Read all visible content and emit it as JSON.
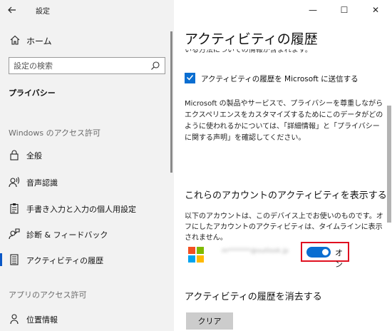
{
  "window": {
    "app_title": "設定",
    "controls": {
      "minimize": "—",
      "maximize": "☐",
      "close": "✕"
    }
  },
  "sidebar": {
    "back_icon": "arrow-left-icon",
    "home_label": "ホーム",
    "search_placeholder": "設定の検索",
    "heading": "プライバシー",
    "section_windows": "Windows のアクセス許可",
    "items": [
      {
        "label": "全般",
        "icon": "lock-icon"
      },
      {
        "label": "音声認識",
        "icon": "speech-icon"
      },
      {
        "label": "手書き入力と入力の個人用設定",
        "icon": "clipboard-pen-icon"
      },
      {
        "label": "診断 & フィードバック",
        "icon": "feedback-icon"
      },
      {
        "label": "アクティビティの履歴",
        "icon": "activity-history-icon",
        "selected": true
      }
    ],
    "section_apps": "アプリのアクセス許可",
    "app_items": [
      {
        "label": "位置情報",
        "icon": "location-icon"
      }
    ]
  },
  "content": {
    "page_title": "アクティビティの履歴",
    "cut_text": "いる方法についての情報が含まれます。",
    "checkbox_label": "アクティビティの履歴を Microsoft に送信する",
    "checkbox_checked": true,
    "paragraph": "Microsoft の製品やサービスで、プライバシーを尊重しながらエクスペリエンスをカスタマイズするためにこのデータがどのように使われるかについては、「詳細情報」と「プライバシーに関する声明」を確認してください。",
    "accounts_heading": "これらのアカウントのアクティビティを表示する",
    "accounts_desc": "以下のアカウントは、このデバイス上でお使いのものです。オフにしたアカウントのアクティビティは、タイムラインに表示されません。",
    "account_email": "m*******@outlook.jp",
    "toggle_state": "オン",
    "toggle_on": true,
    "clear_heading": "アクティビティの履歴を消去する",
    "clear_button": "クリア",
    "accent_color": "#0a6ed1",
    "highlight_color": "#e01020"
  }
}
